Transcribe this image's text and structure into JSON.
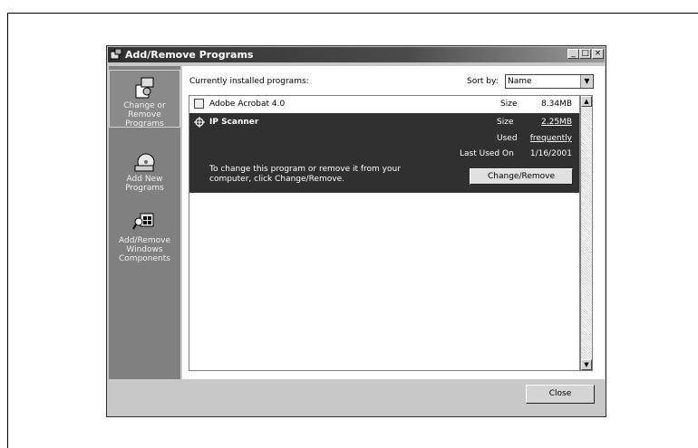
{
  "window": {
    "title": "Add/Remove Programs",
    "controls": {
      "minimize": "_",
      "maximize": "□",
      "close": "×"
    }
  },
  "sidebar": {
    "items": [
      {
        "label": "Change or Remove Programs",
        "icon": "change-remove-icon",
        "selected": true
      },
      {
        "label": "Add New Programs",
        "icon": "add-new-programs-icon",
        "selected": false
      },
      {
        "label": "Add/Remove Windows Components",
        "icon": "windows-components-icon",
        "selected": false
      }
    ]
  },
  "main": {
    "header_label": "Currently installed programs:",
    "sort_label": "Sort by:",
    "sort_value": "Name",
    "programs": [
      {
        "name": "Adobe Acrobat 4.0",
        "size_label": "Size",
        "size_value": "8.34MB"
      },
      {
        "name": "IP Scanner",
        "size_label": "Size",
        "size_value": "2.25MB",
        "used_label": "Used",
        "used_value": "frequently",
        "last_used_label": "Last Used On",
        "last_used_value": "1/16/2001",
        "description": "To change this program or remove it from your computer, click Change/Remove.",
        "button_label": "Change/Remove"
      }
    ]
  },
  "footer": {
    "close_label": "Close"
  },
  "colors": {
    "selected_row_bg": "#303030",
    "sidebar_bg": "#808080",
    "window_bg": "#c8c8c8"
  }
}
